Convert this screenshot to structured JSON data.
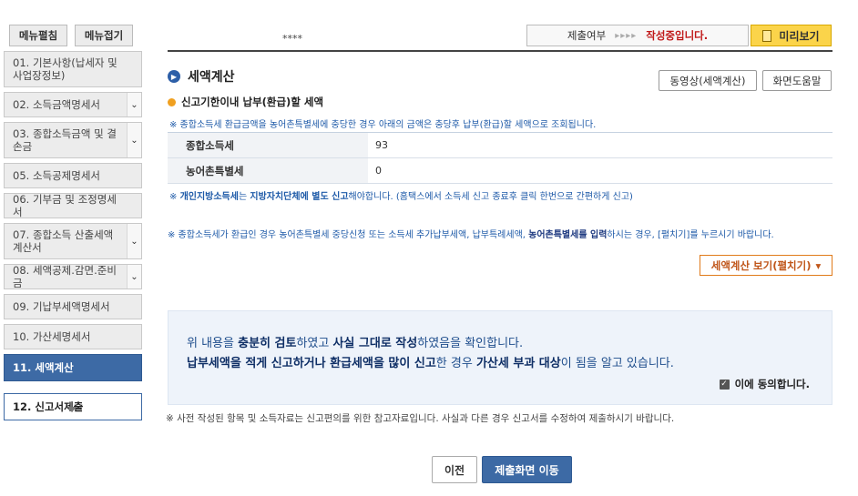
{
  "sidebar": {
    "expand_all": "메뉴펼침",
    "collapse_all": "메뉴접기",
    "items": [
      {
        "label": "01. 기본사항(납세자 및 사업장정보)"
      },
      {
        "label": "02. 소득금액명세서"
      },
      {
        "label": "03. 종합소득금액 및 결손금"
      },
      {
        "label": "05. 소득공제명세서"
      },
      {
        "label": "06. 기부금 및 조정명세서"
      },
      {
        "label": "07. 종합소득 산출세액계산서"
      },
      {
        "label": "08. 세액공제.감면.준비금"
      },
      {
        "label": "09. 기납부세액명세서"
      },
      {
        "label": "10. 가산세명세서"
      },
      {
        "label": "11. 세액계산"
      },
      {
        "label": "12. 신고서제출"
      }
    ]
  },
  "header": {
    "masked_name": "****",
    "status_label": "제출여부",
    "status_arrows": "▸▸▸▸",
    "status_value": "작성중",
    "status_suffix": "입니다.",
    "preview": "미리보기"
  },
  "main": {
    "title": "세액계산",
    "video_button": "동영상(세액계산)",
    "help_button": "화면도움말",
    "subtitle": "신고기한이내 납부(환급)할 세액",
    "note1": "※ 종합소득세 환급금액을 농어촌특별세에 충당한 경우 아래의 금액은 충당후 납부(환급)할 세액으로 조회됩니다.",
    "rows": [
      {
        "label": "종합소득세",
        "value": "93"
      },
      {
        "label": "농어촌특별세",
        "value": "0"
      }
    ],
    "local_note_pre": "※ ",
    "local_note_b1": "개인지방소득세",
    "local_note_mid": "는 ",
    "local_note_b2": "지방자치단체에 별도 신고",
    "local_note_post": "해야합니다. (홈택스에서 소득세 신고 종료후 클릭 한번으로 간편하게 신고)",
    "rural_note_pre": "※ 종합소득세가 환급인 경우 농어촌특별세 중당신청 또는 소득세 추가납부세액, 납부특례세액, ",
    "rural_note_b": "농어촌특별세를 입력",
    "rural_note_post": "하시는 경우, [펼치기]를 누르시기 바랍니다.",
    "expand_button": "세액계산 보기(펼치기)",
    "confirm": {
      "l1_a": "위 내용을 ",
      "l1_b": "충분히 검토",
      "l1_c": "하였고 ",
      "l1_d": "사실 그대로 작성",
      "l1_e": "하였음을 확인합니다.",
      "l2_a": "납부세액을 적게 신고하거나 환급세액을 많이 신고",
      "l2_b": "한 경우 ",
      "l2_c": "가산세 부과 대상",
      "l2_d": "이 됨을 알고 있습니다.",
      "agree": "이에 동의합니다."
    },
    "ref_note": "※ 사전 작성된 항목 및 소득자료는 신고편의를 위한 참고자료입니다. 사실과 다른 경우 신고서를 수정하여 제출하시기 바랍니다.",
    "prev_button": "이전",
    "submit_button": "제출화면 이동"
  }
}
